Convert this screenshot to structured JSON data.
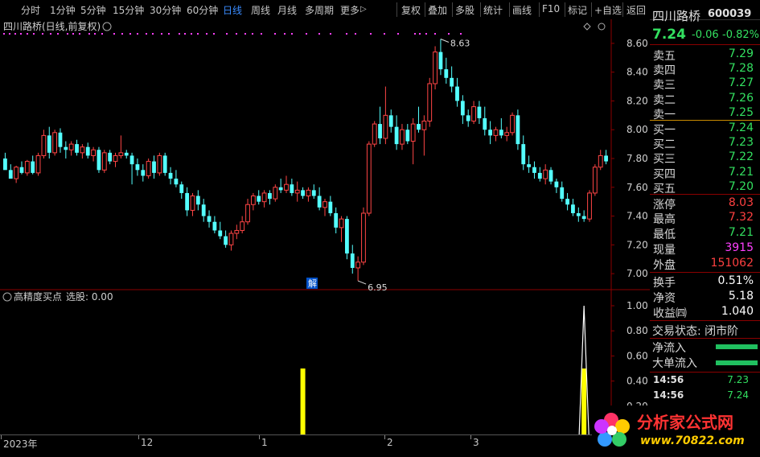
{
  "toolbar": {
    "items": [
      "分时",
      "1分钟",
      "5分钟",
      "15分钟",
      "30分钟",
      "60分钟",
      "日线",
      "周线",
      "月线",
      "多周期",
      "更多"
    ],
    "right_items": [
      "复权",
      "叠加",
      "多股",
      "统计",
      "画线",
      "F10",
      "标记",
      "+自选",
      "返回"
    ],
    "active": "日线",
    "more_arrow": "▷"
  },
  "chart": {
    "title": "四川路桥(日线,前复权)",
    "y_labels": [
      "8.60",
      "8.40",
      "8.20",
      "8.00",
      "7.80",
      "7.60",
      "7.40",
      "7.20",
      "7.00"
    ],
    "high_marker": "8.63",
    "low_marker": "6.95",
    "jie_badge": "解"
  },
  "indicator": {
    "title": "高精度买点",
    "subtitle": "选股: 0.00",
    "y_labels": [
      "1.00",
      "0.80",
      "0.60",
      "0.40",
      "0.20"
    ]
  },
  "date_axis": [
    "2023年",
    "12",
    "1",
    "2",
    "3"
  ],
  "quote": {
    "name": "四川路桥",
    "code": "600039",
    "price": "7.24",
    "change": "-0.06",
    "change_pct": "-0.82%",
    "asks": [
      {
        "label": "卖五",
        "price": "7.29"
      },
      {
        "label": "卖四",
        "price": "7.28"
      },
      {
        "label": "卖三",
        "price": "7.27"
      },
      {
        "label": "卖二",
        "price": "7.26"
      },
      {
        "label": "卖一",
        "price": "7.25"
      }
    ],
    "bids": [
      {
        "label": "买一",
        "price": "7.24"
      },
      {
        "label": "买二",
        "price": "7.23"
      },
      {
        "label": "买三",
        "price": "7.22"
      },
      {
        "label": "买四",
        "price": "7.21"
      },
      {
        "label": "买五",
        "price": "7.20"
      }
    ],
    "stats": [
      {
        "label": "涨停",
        "value": "8.03",
        "color": "red"
      },
      {
        "label": "最高",
        "value": "7.32",
        "color": "red"
      },
      {
        "label": "最低",
        "value": "7.21",
        "color": "green"
      },
      {
        "label": "现量",
        "value": "3915",
        "color": "purple"
      },
      {
        "label": "外盘",
        "value": "151062",
        "color": "red"
      },
      {
        "label": "换手",
        "value": "0.51%",
        "color": "white"
      },
      {
        "label": "净资",
        "value": "5.18",
        "color": "white"
      },
      {
        "label": "收益㈣",
        "value": "1.040",
        "color": "white"
      }
    ],
    "trade_status": "交易状态: 闭市阶",
    "net_inflow": "净流入",
    "big_inflow": "大单流入",
    "ticks": [
      {
        "time": "14:56",
        "price": "7.23"
      },
      {
        "time": "14:56",
        "price": "7.24"
      }
    ]
  },
  "logo": {
    "name": "分析家公式网",
    "url": "www.70822.com"
  },
  "colors": {
    "up": "#ff4545",
    "down": "#54ffff",
    "grid": "#5a0000",
    "signal": "#ffff00",
    "dot": "#ff40ff"
  },
  "chart_data": {
    "type": "candlestick",
    "y_range": [
      6.9,
      8.7
    ],
    "candles": [
      [
        7.8,
        7.84,
        7.74,
        7.72
      ],
      [
        7.72,
        7.76,
        7.66,
        7.66
      ],
      [
        7.66,
        7.75,
        7.63,
        7.74
      ],
      [
        7.74,
        7.78,
        7.69,
        7.7
      ],
      [
        7.7,
        7.79,
        7.68,
        7.78
      ],
      [
        7.78,
        7.82,
        7.69,
        7.7
      ],
      [
        7.7,
        7.84,
        7.68,
        7.82
      ],
      [
        7.82,
        8.0,
        7.8,
        7.96
      ],
      [
        7.96,
        8.02,
        7.8,
        7.84
      ],
      [
        7.84,
        8.0,
        7.82,
        7.98
      ],
      [
        7.98,
        8.01,
        7.84,
        7.88
      ],
      [
        7.88,
        7.92,
        7.8,
        7.86
      ],
      [
        7.86,
        7.92,
        7.82,
        7.9
      ],
      [
        7.9,
        7.93,
        7.82,
        7.84
      ],
      [
        7.84,
        7.9,
        7.8,
        7.88
      ],
      [
        7.88,
        7.91,
        7.8,
        7.82
      ],
      [
        7.82,
        7.88,
        7.78,
        7.86
      ],
      [
        7.86,
        7.88,
        7.7,
        7.72
      ],
      [
        7.72,
        7.86,
        7.7,
        7.84
      ],
      [
        7.84,
        7.86,
        7.76,
        7.78
      ],
      [
        7.78,
        7.84,
        7.74,
        7.82
      ],
      [
        7.82,
        7.96,
        7.8,
        7.84
      ],
      [
        7.84,
        7.86,
        7.8,
        7.82
      ],
      [
        7.82,
        7.84,
        7.62,
        7.76
      ],
      [
        7.76,
        7.8,
        7.68,
        7.72
      ],
      [
        7.72,
        7.76,
        7.64,
        7.68
      ],
      [
        7.68,
        7.8,
        7.66,
        7.78
      ],
      [
        7.78,
        7.82,
        7.66,
        7.7
      ],
      [
        7.7,
        7.84,
        7.68,
        7.82
      ],
      [
        7.82,
        7.84,
        7.68,
        7.7
      ],
      [
        7.7,
        7.74,
        7.62,
        7.66
      ],
      [
        7.66,
        7.72,
        7.6,
        7.62
      ],
      [
        7.62,
        7.64,
        7.52,
        7.56
      ],
      [
        7.56,
        7.6,
        7.4,
        7.44
      ],
      [
        7.44,
        7.56,
        7.4,
        7.54
      ],
      [
        7.54,
        7.58,
        7.44,
        7.48
      ],
      [
        7.48,
        7.52,
        7.36,
        7.4
      ],
      [
        7.4,
        7.44,
        7.32,
        7.36
      ],
      [
        7.36,
        7.4,
        7.28,
        7.3
      ],
      [
        7.3,
        7.36,
        7.24,
        7.26
      ],
      [
        7.26,
        7.3,
        7.18,
        7.2
      ],
      [
        7.2,
        7.3,
        7.16,
        7.28
      ],
      [
        7.28,
        7.34,
        7.24,
        7.3
      ],
      [
        7.3,
        7.4,
        7.28,
        7.36
      ],
      [
        7.36,
        7.52,
        7.34,
        7.48
      ],
      [
        7.48,
        7.56,
        7.44,
        7.54
      ],
      [
        7.54,
        7.58,
        7.48,
        7.5
      ],
      [
        7.5,
        7.58,
        7.46,
        7.56
      ],
      [
        7.56,
        7.58,
        7.48,
        7.52
      ],
      [
        7.52,
        7.62,
        7.5,
        7.6
      ],
      [
        7.6,
        7.66,
        7.56,
        7.58
      ],
      [
        7.58,
        7.68,
        7.56,
        7.62
      ],
      [
        7.62,
        7.66,
        7.54,
        7.56
      ],
      [
        7.56,
        7.64,
        7.5,
        7.58
      ],
      [
        7.58,
        7.6,
        7.52,
        7.54
      ],
      [
        7.54,
        7.6,
        7.5,
        7.58
      ],
      [
        7.58,
        7.62,
        7.52,
        7.54
      ],
      [
        7.54,
        7.6,
        7.44,
        7.46
      ],
      [
        7.46,
        7.52,
        7.4,
        7.5
      ],
      [
        7.5,
        7.54,
        7.4,
        7.42
      ],
      [
        7.42,
        7.46,
        7.28,
        7.32
      ],
      [
        7.32,
        7.4,
        7.22,
        7.38
      ],
      [
        7.38,
        7.4,
        7.1,
        7.14
      ],
      [
        7.14,
        7.2,
        7.0,
        7.04
      ],
      [
        7.04,
        7.12,
        6.95,
        7.08
      ],
      [
        7.08,
        7.46,
        7.06,
        7.42
      ],
      [
        7.42,
        7.92,
        7.4,
        7.9
      ],
      [
        7.9,
        8.06,
        7.88,
        8.04
      ],
      [
        8.04,
        8.16,
        7.9,
        7.94
      ],
      [
        7.94,
        8.3,
        7.9,
        8.1
      ],
      [
        8.1,
        8.14,
        7.98,
        8.02
      ],
      [
        8.02,
        8.1,
        7.86,
        7.9
      ],
      [
        7.9,
        8.04,
        7.86,
        8.0
      ],
      [
        8.0,
        8.04,
        7.9,
        7.92
      ],
      [
        7.92,
        8.08,
        7.76,
        8.04
      ],
      [
        8.04,
        8.16,
        7.98,
        8.0
      ],
      [
        8.0,
        8.1,
        7.82,
        8.06
      ],
      [
        8.06,
        8.36,
        8.02,
        8.32
      ],
      [
        8.32,
        8.58,
        8.28,
        8.54
      ],
      [
        8.54,
        8.63,
        8.38,
        8.42
      ],
      [
        8.42,
        8.5,
        8.32,
        8.36
      ],
      [
        8.36,
        8.44,
        8.26,
        8.3
      ],
      [
        8.3,
        8.36,
        8.16,
        8.2
      ],
      [
        8.2,
        8.24,
        8.04,
        8.1
      ],
      [
        8.1,
        8.14,
        8.02,
        8.06
      ],
      [
        8.06,
        8.2,
        8.04,
        8.16
      ],
      [
        8.16,
        8.2,
        8.04,
        8.08
      ],
      [
        8.08,
        8.16,
        7.96,
        8.0
      ],
      [
        8.0,
        8.06,
        7.9,
        7.96
      ],
      [
        7.96,
        8.02,
        7.92,
        8.0
      ],
      [
        8.0,
        8.08,
        7.94,
        7.96
      ],
      [
        7.96,
        8.02,
        7.92,
        7.98
      ],
      [
        7.98,
        8.12,
        7.96,
        8.1
      ],
      [
        8.1,
        8.14,
        7.86,
        7.9
      ],
      [
        7.9,
        7.96,
        7.72,
        7.76
      ],
      [
        7.76,
        7.82,
        7.7,
        7.74
      ],
      [
        7.74,
        7.78,
        7.66,
        7.7
      ],
      [
        7.7,
        7.74,
        7.64,
        7.66
      ],
      [
        7.66,
        7.76,
        7.62,
        7.72
      ],
      [
        7.72,
        7.74,
        7.62,
        7.64
      ],
      [
        7.64,
        7.66,
        7.56,
        7.6
      ],
      [
        7.6,
        7.64,
        7.5,
        7.52
      ],
      [
        7.52,
        7.56,
        7.44,
        7.48
      ],
      [
        7.48,
        7.52,
        7.4,
        7.42
      ],
      [
        7.42,
        7.46,
        7.36,
        7.4
      ],
      [
        7.4,
        7.44,
        7.36,
        7.38
      ],
      [
        7.38,
        7.58,
        7.36,
        7.56
      ],
      [
        7.56,
        7.76,
        7.54,
        7.74
      ],
      [
        7.74,
        7.86,
        7.72,
        7.82
      ],
      [
        7.82,
        7.86,
        7.76,
        7.78
      ]
    ],
    "signals": [
      {
        "index": 54,
        "value": 0.5,
        "type": "bar"
      },
      {
        "index": 105,
        "value": 0.5,
        "type": "bar"
      },
      {
        "index": 105,
        "value": 1.0,
        "type": "spike"
      }
    ]
  }
}
